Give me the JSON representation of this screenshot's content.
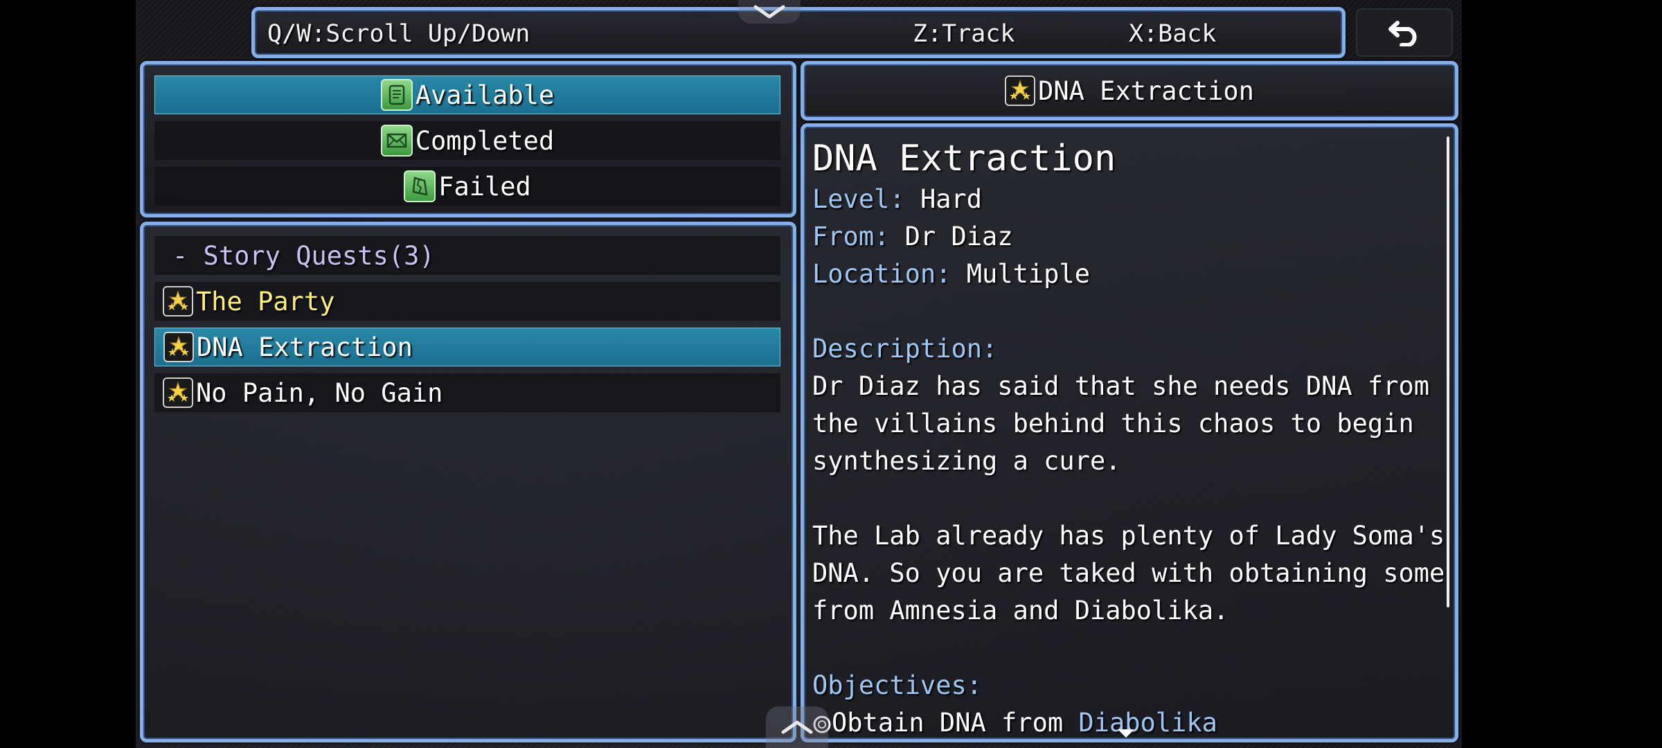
{
  "help_bar": {
    "scroll_hint": "Q/W:Scroll Up/Down",
    "track_hint": "Z:Track",
    "back_hint": "X:Back"
  },
  "categories": [
    {
      "label": "Available",
      "icon": "scroll-icon",
      "selected": true
    },
    {
      "label": "Completed",
      "icon": "envelope-icon",
      "selected": false
    },
    {
      "label": "Failed",
      "icon": "torn-paper-icon",
      "selected": false
    }
  ],
  "quest_list": {
    "group_header": "- Story Quests(3)",
    "items": [
      {
        "label": "The Party",
        "icon": "stars-icon",
        "color": "#ffef7a",
        "selected": false
      },
      {
        "label": "DNA Extraction",
        "icon": "stars-icon",
        "color": "#ffffff",
        "selected": true
      },
      {
        "label": "No Pain, No Gain",
        "icon": "stars-icon",
        "color": "#ffffff",
        "selected": false
      }
    ]
  },
  "detail": {
    "header": "DNA Extraction",
    "title": "DNA Extraction",
    "level_label": "Level:",
    "level_value": "Hard",
    "from_label": "From:",
    "from_value": "Dr Diaz",
    "location_label": "Location:",
    "location_value": "Multiple",
    "description_label": "Description:",
    "description_lines": [
      "Dr Diaz has said that she needs DNA from",
      "the villains behind this chaos to begin",
      "synthesizing a cure.",
      "",
      "The Lab already has plenty of Lady Soma's",
      "DNA. So you are taked with obtaining some",
      "from Amnesia and Diabolika."
    ],
    "objectives_label": "Objectives:",
    "objective_prefix": "Obtain DNA from",
    "objective_target": "Diabolika"
  },
  "colors": {
    "frame": "#86aee8",
    "selection": "#1b6f8f",
    "label_blue": "#9fc6f2",
    "quest_yellow": "#ffef7a"
  }
}
